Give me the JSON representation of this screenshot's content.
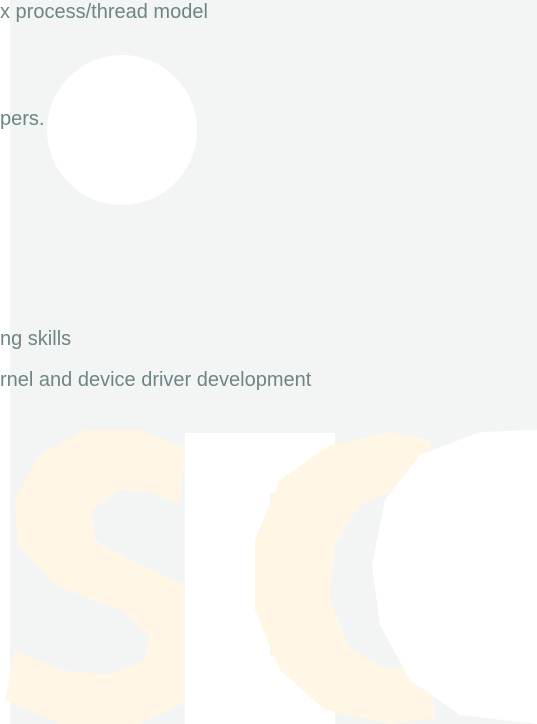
{
  "content": {
    "lines": [
      "x process/thread model",
      "pers.",
      "ng skills",
      "rnel and device driver development"
    ]
  },
  "logo": {
    "letters": [
      "S",
      "E",
      "C",
      "C"
    ],
    "colors": {
      "s": "#fff6e6",
      "e": "#ffffff",
      "c1": "#fff6e6",
      "c2": "#ffffff"
    }
  }
}
